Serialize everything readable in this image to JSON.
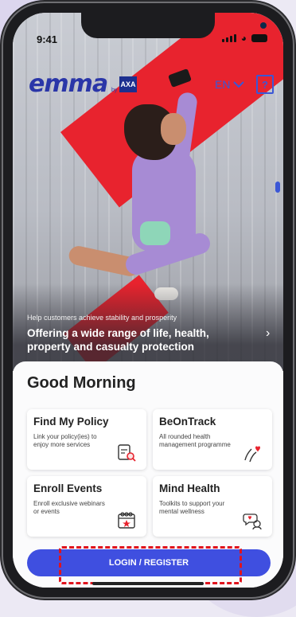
{
  "status": {
    "time": "9:41"
  },
  "header": {
    "brand": "emma",
    "by": "by",
    "partner": "AXA",
    "language": "EN"
  },
  "hero": {
    "subtitle": "Help customers achieve stability and prosperity",
    "title": "Offering a wide range of life, health, property and casualty protection"
  },
  "greeting": "Good Morning",
  "cards": [
    {
      "title": "Find My Policy",
      "desc": "Link your policy(ies) to enjoy more services",
      "icon": "policy-search-icon"
    },
    {
      "title": "BeOnTrack",
      "desc": "All rounded health management programme",
      "icon": "health-tracker-icon"
    },
    {
      "title": "Enroll Events",
      "desc": "Enroll exclusive webinars or events",
      "icon": "calendar-event-icon"
    },
    {
      "title": "Mind Health",
      "desc": "Toolkits to support your mental wellness",
      "icon": "mind-health-icon"
    }
  ],
  "login_label": "LOGIN / REGISTER",
  "colors": {
    "brand": "#2a36a8",
    "accent": "#3f4fe0",
    "highlight": "#e0131d",
    "hero_stripe": "#e8232e"
  }
}
